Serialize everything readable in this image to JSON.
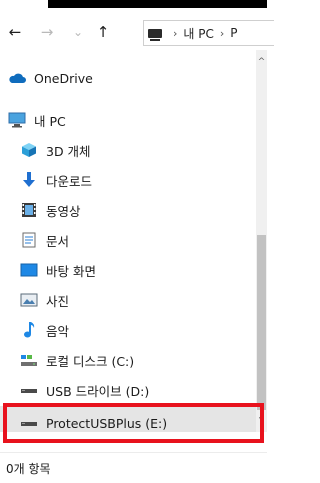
{
  "address_bar": {
    "crumbs": [
      "내 PC",
      "P"
    ]
  },
  "nav": {
    "back": "←",
    "forward": "→",
    "recent": "⌄",
    "up": "↑"
  },
  "sidebar": {
    "items": [
      {
        "label": "OneDrive",
        "icon": "onedrive-cloud-icon"
      },
      {
        "label": "내 PC",
        "icon": "pc-icon"
      },
      {
        "label": "3D 개체",
        "icon": "3d-objects-icon"
      },
      {
        "label": "다운로드",
        "icon": "download-icon"
      },
      {
        "label": "동영상",
        "icon": "video-icon"
      },
      {
        "label": "문서",
        "icon": "document-icon"
      },
      {
        "label": "바탕 화면",
        "icon": "desktop-icon"
      },
      {
        "label": "사진",
        "icon": "pictures-icon"
      },
      {
        "label": "음악",
        "icon": "music-icon"
      },
      {
        "label": "로컬 디스크 (C:)",
        "icon": "local-disk-icon"
      },
      {
        "label": "USB 드라이브 (D:)",
        "icon": "usb-drive-icon"
      },
      {
        "label": "ProtectUSBPlus (E:)",
        "icon": "usb-drive-icon"
      }
    ]
  },
  "status_bar": {
    "count": "0개 항목"
  },
  "colors": {
    "highlight_border": "#e8121d",
    "selected_bg": "#e5e5e5",
    "onedrive_blue": "#0f6cbd"
  }
}
